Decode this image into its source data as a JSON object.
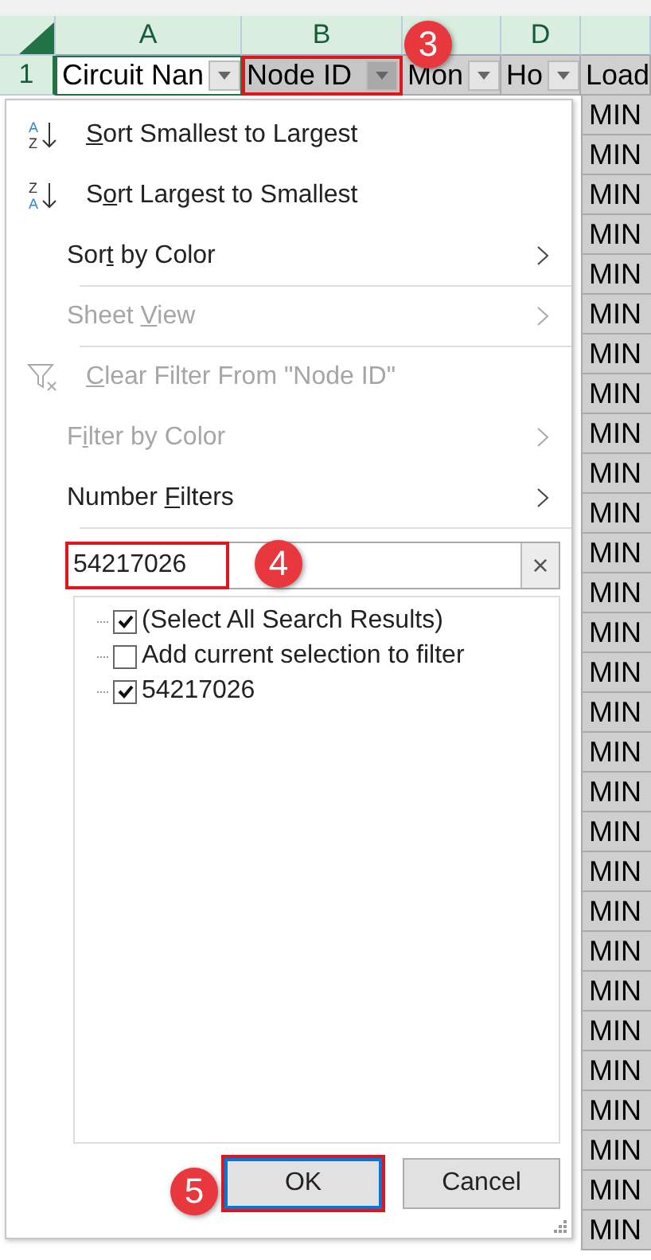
{
  "sheet": {
    "columns": [
      {
        "letter": "A"
      },
      {
        "letter": "B"
      },
      {},
      {
        "letter": "D"
      },
      {}
    ],
    "header_row": {
      "number": "1",
      "cells": [
        {
          "text": "Circuit Nan",
          "filter": true,
          "highlighted": false
        },
        {
          "text": "Node ID",
          "filter": true,
          "highlighted": true
        },
        {
          "text": "Mon",
          "filter": true,
          "highlighted": false
        },
        {
          "text": "Ho",
          "filter": true,
          "highlighted": false
        },
        {
          "text": "Load",
          "highlighted": false
        }
      ]
    },
    "column_e_cells": [
      "MIN",
      "MIN",
      "MIN",
      "MIN",
      "MIN",
      "MIN",
      "MIN",
      "MIN",
      "MIN",
      "MIN",
      "MIN",
      "MIN",
      "MIN",
      "MIN",
      "MIN",
      "MIN",
      "MIN",
      "MIN",
      "MIN",
      "MIN",
      "MIN",
      "MIN",
      "MIN",
      "MIN",
      "MIN",
      "MIN",
      "MIN",
      "MIN",
      "MIN"
    ]
  },
  "filter_menu": {
    "items": [
      {
        "kind": "sort",
        "icon_text": [
          "A",
          "Z"
        ],
        "mnemonic": "S",
        "after": "ort Smallest to Largest",
        "disabled": false,
        "submenu": false,
        "separator_after": false
      },
      {
        "kind": "sort",
        "icon_text": [
          "Z",
          "A"
        ],
        "before": "S",
        "mnemonic": "o",
        "after": "rt Largest to Smallest",
        "disabled": false,
        "submenu": false,
        "separator_after": false
      },
      {
        "kind": "plain",
        "before": "Sor",
        "mnemonic": "t",
        "after": " by Color",
        "disabled": false,
        "submenu": true,
        "separator_after": true
      },
      {
        "kind": "plain",
        "before": "Sheet ",
        "mnemonic": "V",
        "after": "iew",
        "disabled": true,
        "submenu": true,
        "separator_after": true
      },
      {
        "kind": "clear",
        "mnemonic": "C",
        "after": "lear Filter From \"Node ID\"",
        "disabled": true,
        "submenu": false,
        "separator_after": false
      },
      {
        "kind": "plain",
        "before": "F",
        "mnemonic": "i",
        "after": "lter by Color",
        "disabled": true,
        "submenu": true,
        "separator_after": false
      },
      {
        "kind": "plain",
        "before": "Number ",
        "mnemonic": "F",
        "after": "ilters",
        "disabled": false,
        "submenu": true,
        "separator_after": true
      }
    ],
    "search": {
      "value": "54217026",
      "highlighted": true,
      "clear_label": "×"
    },
    "checklist": [
      {
        "label": "(Select All Search Results)",
        "checked": true
      },
      {
        "label": "Add current selection to filter",
        "checked": false
      },
      {
        "label": "54217026",
        "checked": true
      }
    ],
    "buttons": [
      {
        "label": "OK",
        "default": true,
        "highlighted": true
      },
      {
        "label": "Cancel",
        "default": false,
        "highlighted": false
      }
    ]
  },
  "step_badges": [
    {
      "number": "3"
    },
    {
      "number": "4"
    },
    {
      "number": "5"
    }
  ]
}
